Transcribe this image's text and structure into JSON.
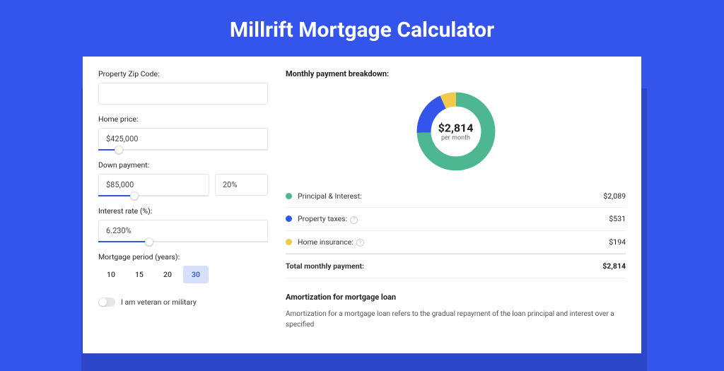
{
  "title": "Millrift Mortgage Calculator",
  "form": {
    "zip_label": "Property Zip Code:",
    "zip_value": "",
    "home_price_label": "Home price:",
    "home_price_value": "$425,000",
    "home_price_slider_pct": 12,
    "down_label": "Down payment:",
    "down_value": "$85,000",
    "down_pct": "20%",
    "down_slider_pct": 22,
    "rate_label": "Interest rate (%):",
    "rate_value": "6.230%",
    "rate_slider_pct": 30,
    "period_label": "Mortgage period (years):",
    "periods": [
      "10",
      "15",
      "20",
      "30"
    ],
    "period_selected": "30",
    "veteran_label": "I am veteran or military",
    "veteran_on": false
  },
  "breakdown": {
    "title": "Monthly payment breakdown:",
    "center_amount": "$2,814",
    "center_sub": "per month",
    "rows": [
      {
        "color": "green",
        "label": "Principal & Interest:",
        "value": "$2,089",
        "help": false
      },
      {
        "color": "blue",
        "label": "Property taxes:",
        "value": "$531",
        "help": true
      },
      {
        "color": "yellow",
        "label": "Home insurance:",
        "value": "$194",
        "help": true
      }
    ],
    "total_label": "Total monthly payment:",
    "total_value": "$2,814"
  },
  "amort": {
    "title": "Amortization for mortgage loan",
    "text": "Amortization for a mortgage loan refers to the gradual repayment of the loan principal and interest over a specified"
  },
  "chart_data": {
    "type": "pie",
    "title": "Monthly payment breakdown",
    "series": [
      {
        "name": "Principal & Interest",
        "value": 2089,
        "color": "#4DB792"
      },
      {
        "name": "Property taxes",
        "value": 531,
        "color": "#3355EB"
      },
      {
        "name": "Home insurance",
        "value": 194,
        "color": "#F2C94C"
      }
    ],
    "total": 2814
  }
}
